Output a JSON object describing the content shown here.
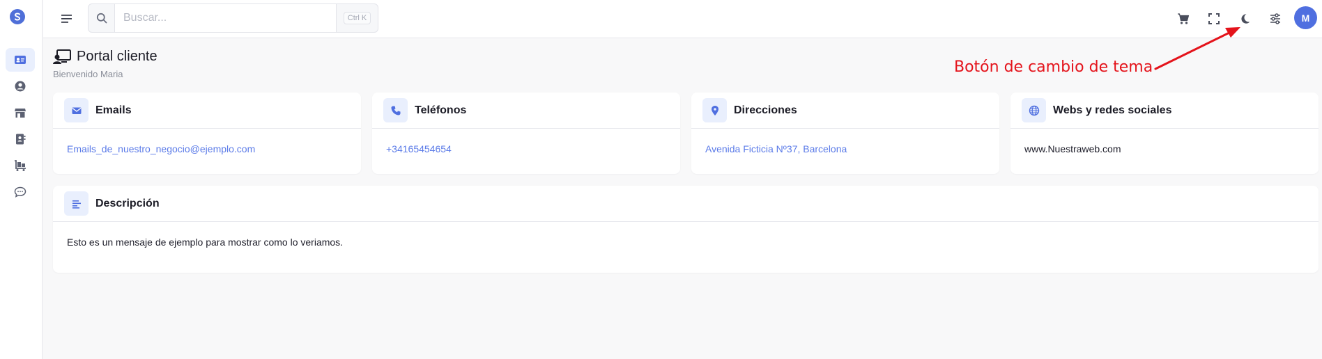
{
  "header": {
    "search_placeholder": "Buscar...",
    "search_shortcut": "Ctrl K",
    "avatar_initial": "M"
  },
  "page": {
    "title": "Portal cliente",
    "subtitle": "Bienvenido Maria"
  },
  "annotation": {
    "text": "Botón de cambio de tema"
  },
  "cards": {
    "emails": {
      "title": "Emails",
      "value": "Emails_de_nuestro_negocio@ejemplo.com"
    },
    "phones": {
      "title": "Teléfonos",
      "value": "+34165454654"
    },
    "addresses": {
      "title": "Direcciones",
      "value": "Avenida Ficticia Nº37, Barcelona"
    },
    "webs": {
      "title": "Webs y redes sociales",
      "value": "www.Nuestraweb.com"
    },
    "description": {
      "title": "Descripción",
      "value": "Esto es un mensaje de ejemplo para mostrar como lo veriamos."
    }
  },
  "colors": {
    "accent": "#4f6fe0",
    "link": "#5b7be8",
    "annotation": "#e4131b",
    "icon_bg": "#e9effd"
  },
  "icons": {
    "sidebar": [
      "contact-card-icon",
      "user-circle-icon",
      "store-icon",
      "address-book-icon",
      "cart-dolly-icon",
      "chat-icon"
    ],
    "header": [
      "cart-icon",
      "fullscreen-icon",
      "moon-icon",
      "sliders-icon"
    ]
  }
}
